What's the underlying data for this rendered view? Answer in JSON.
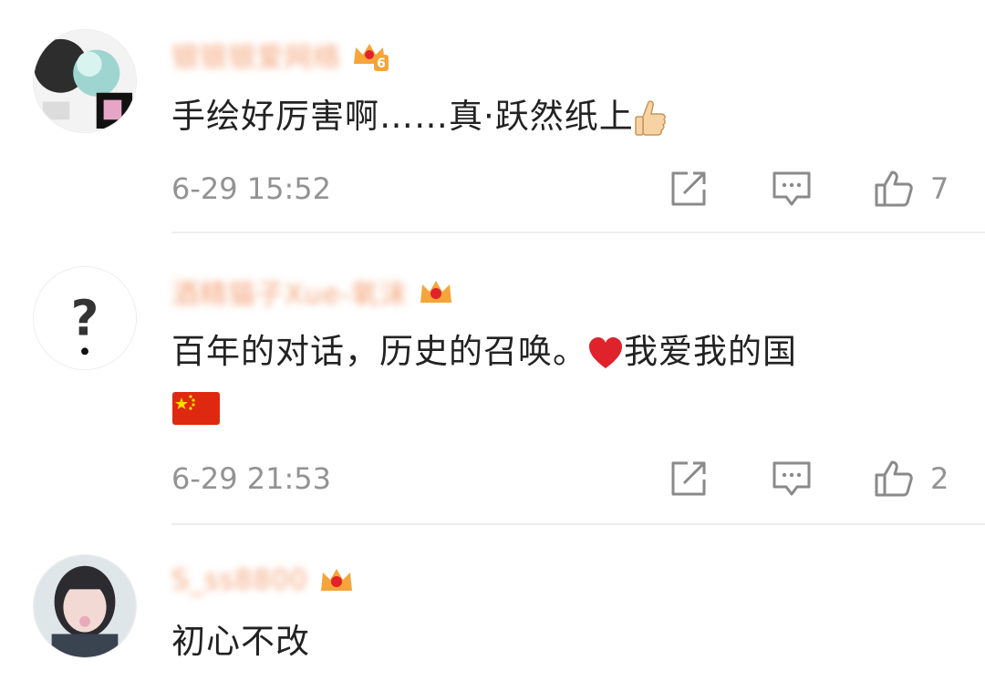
{
  "comments": [
    {
      "username": "银银银爱网络",
      "vip_level": "6",
      "text": "手绘好厉害啊……真·跃然纸上",
      "trailing_emoji": "thumbs-up-emoji",
      "time": "6-29 15:52",
      "likes": "7"
    },
    {
      "username": "酒精猫子Xue-氧沫",
      "text": "百年的对话，历史的召唤。",
      "inline_emoji": "red-heart-emoji",
      "text_after": "我爱我的国",
      "trailing_emoji": "china-flag-emoji",
      "time": "6-29 21:53",
      "likes": "2"
    },
    {
      "username": "S_ss8800",
      "text": "初心不改"
    }
  ],
  "icons": {
    "repost": "share-icon",
    "comment": "comment-icon",
    "like": "thumbs-up-icon"
  },
  "colors": {
    "username": "#f4a47a",
    "meta": "#939393",
    "text": "#222222",
    "badge": "#f5a53a",
    "heart": "#e0222b",
    "flag": "#de2910"
  }
}
